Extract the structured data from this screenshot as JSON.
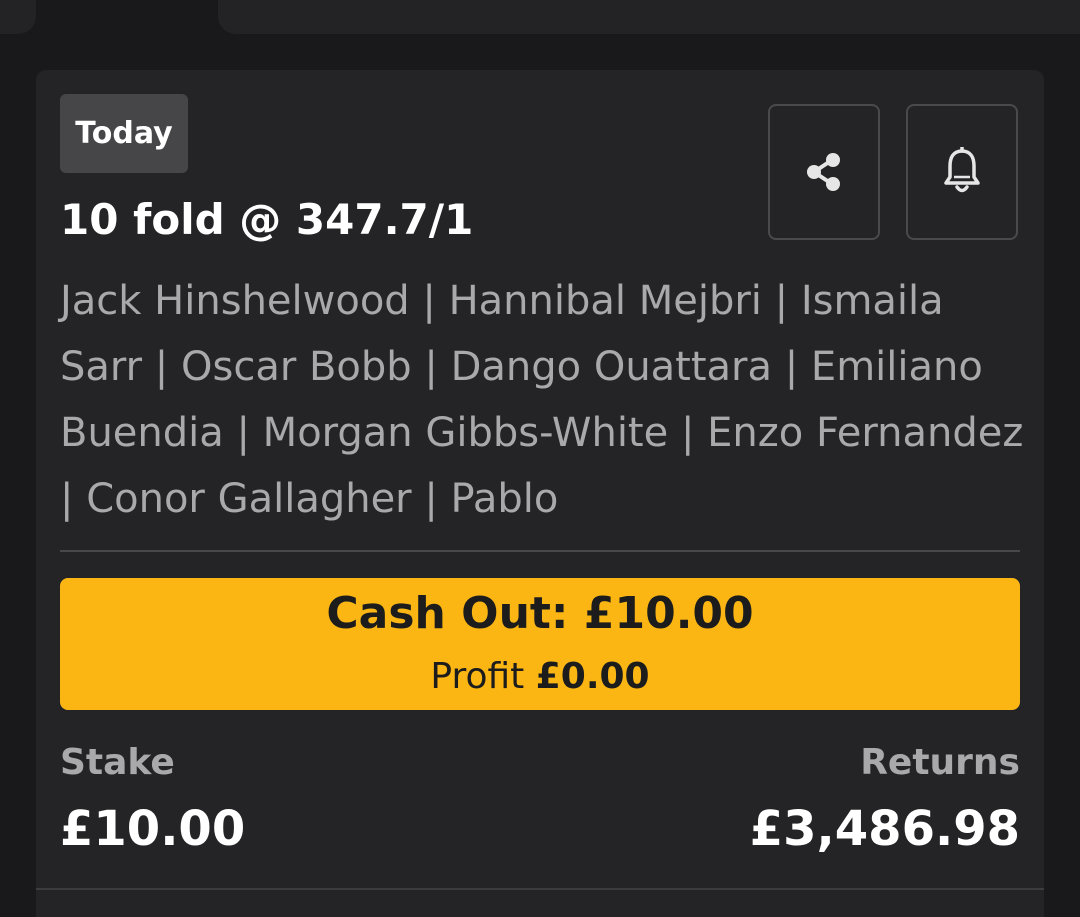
{
  "bet": {
    "date_badge": "Today",
    "title": "10 fold @ 347.7/1",
    "selections": "Jack Hinshelwood | Hannibal Mejbri | Ismaila Sarr | Oscar Bobb | Dango Ouattara | Emiliano Buendia | Morgan Gibbs-White | Enzo Fernandez | Conor Gallagher | Pablo",
    "share_icon": "share-icon",
    "bell_icon": "bell-icon"
  },
  "cash_out": {
    "label": "Cash Out: £10.00",
    "profit_label": "Profit",
    "profit_value": "£0.00",
    "color": "#fbb614"
  },
  "stake": {
    "label": "Stake",
    "value": "£10.00"
  },
  "returns": {
    "label": "Returns",
    "value": "£3,486.98"
  }
}
